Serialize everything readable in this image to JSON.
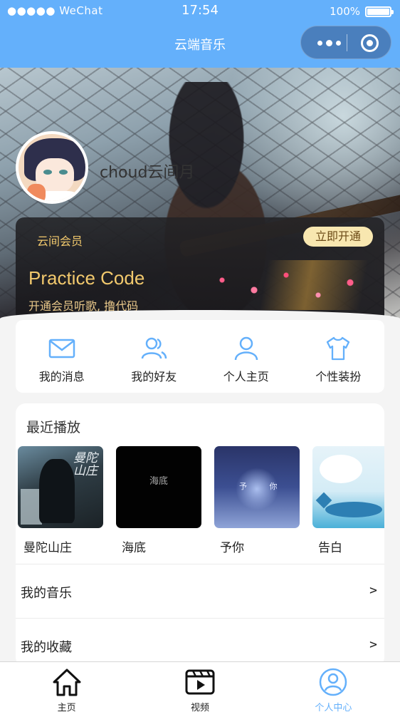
{
  "status_bar": {
    "carrier": "●●●●● WeChat",
    "time": "17:54",
    "battery": "100%"
  },
  "nav": {
    "title": "云端音乐",
    "more_icon": "more-dots-icon",
    "close_icon": "target-icon"
  },
  "profile": {
    "username": "choud云间月"
  },
  "vip": {
    "label": "云间会员",
    "open_button": "立即开通",
    "title": "Practice Code",
    "subtitle": "开通会员听歌, 撸代码"
  },
  "quick_actions": [
    {
      "label": "我的消息",
      "icon": "mail-icon"
    },
    {
      "label": "我的好友",
      "icon": "friends-icon"
    },
    {
      "label": "个人主页",
      "icon": "person-icon"
    },
    {
      "label": "个性装扮",
      "icon": "tshirt-icon"
    }
  ],
  "recent": {
    "title": "最近播放",
    "items": [
      {
        "name": "曼陀山庄",
        "cover_text": "曼陀山庄"
      },
      {
        "name": "海底",
        "cover_text": "海底"
      },
      {
        "name": "予你",
        "cover_text": "予 你"
      },
      {
        "name": "告白",
        "cover_text": ""
      }
    ]
  },
  "menu": [
    {
      "label": "我的音乐",
      "arrow": ">"
    },
    {
      "label": "我的收藏",
      "arrow": ">"
    }
  ],
  "tabbar": [
    {
      "label": "主页",
      "icon": "home-icon"
    },
    {
      "label": "视频",
      "icon": "video-icon"
    },
    {
      "label": "个人中心",
      "icon": "user-center-icon"
    }
  ],
  "colors": {
    "primary": "#64b0fb",
    "vip_gold": "#f2c96d",
    "vip_button": "#f8e7b0"
  }
}
